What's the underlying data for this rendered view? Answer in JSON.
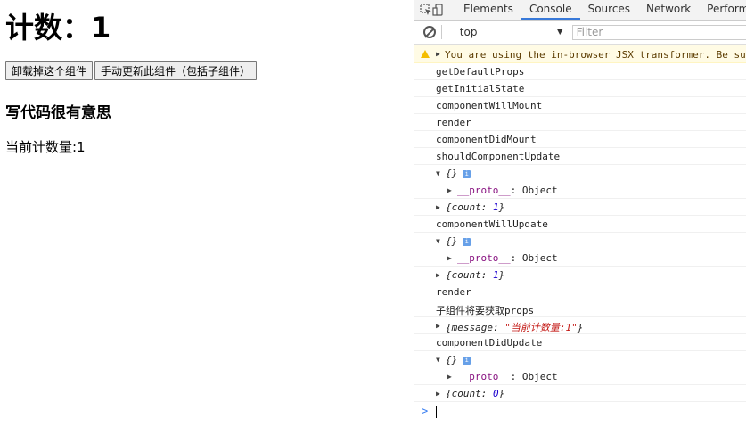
{
  "page": {
    "heading": "计数：1",
    "buttons": [
      "卸载掉这个组件",
      "手动更新此组件（包括子组件）"
    ],
    "subheading": "写代码很有意思",
    "count_text": "当前计数量:1"
  },
  "devtools": {
    "tabs": [
      "Elements",
      "Console",
      "Sources",
      "Network",
      "Perform"
    ],
    "active_tab": "Console",
    "context": "top",
    "filter_placeholder": "Filter",
    "warning": "You are using the in-browser JSX transformer. Be sur",
    "lines": {
      "l1": "getDefaultProps",
      "l2": "getInitialState",
      "l3": "componentWillMount",
      "l4": "render",
      "l5": "componentDidMount",
      "l6": "shouldComponentUpdate",
      "l7": "componentWillUpdate",
      "l8": "render",
      "l9": "子组件将要获取props",
      "l10": "componentDidUpdate"
    },
    "obj_empty": "{}",
    "proto_key": "__proto__",
    "proto_val": ": Object",
    "count1_a": "{count: ",
    "count1_v": "1",
    "count1_b": "}",
    "count2_v": "1",
    "count3_v": "0",
    "message_a": "{message: ",
    "message_v": "\"当前计数量:1\"",
    "message_b": "}",
    "info_badge": "i",
    "prompt_symbol": ">"
  },
  "colors": {
    "active_tab_underline": "#3879d9",
    "warning_bg": "#fffbe5",
    "proto_color": "#881280",
    "number_color": "#1c00cf",
    "string_color": "#c41a16"
  },
  "icons": [
    "inspect-icon",
    "device-icon",
    "clear-console-icon",
    "warning-icon",
    "info-icon",
    "dropdown-arrow-icon"
  ]
}
